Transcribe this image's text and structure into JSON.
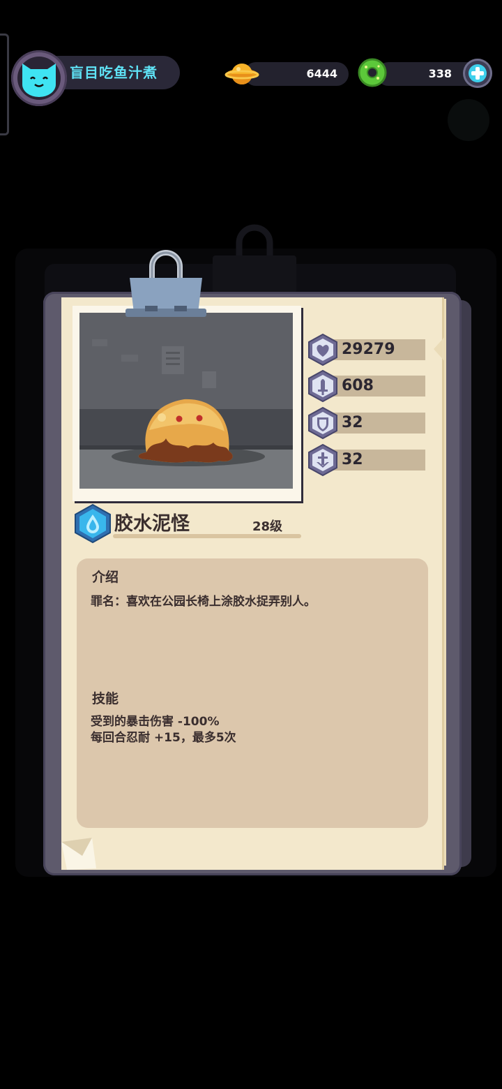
{
  "player": {
    "name": "盲目吃鱼汁煮",
    "avatar_icon": "cat-face-icon"
  },
  "currencies": {
    "coins": {
      "value": "6444",
      "icon": "planet-coin-icon"
    },
    "gems": {
      "value": "338",
      "icon": "green-donut-icon"
    },
    "add_icon": "plus-icon"
  },
  "monster": {
    "name": "胶水泥怪",
    "level": "28级",
    "element_icon": "water-drop-icon",
    "stats": [
      {
        "icon": "heart-icon",
        "value": "29279"
      },
      {
        "icon": "sword-icon",
        "value": "608"
      },
      {
        "icon": "shield-icon",
        "value": "32"
      },
      {
        "icon": "speed-icon",
        "value": "32"
      }
    ]
  },
  "info": {
    "intro_title": "介绍",
    "intro_text": "罪名：喜欢在公园长椅上涂胶水捉弄别人。",
    "skills_title": "技能",
    "skills_text": "受到的暴击伤害 -100%\n每回合忍耐 +15，最多5次"
  },
  "colors": {
    "accent_cyan": "#5fe3f6",
    "paper": "#f3e8cc",
    "stat_hex": "#6e6a94"
  }
}
